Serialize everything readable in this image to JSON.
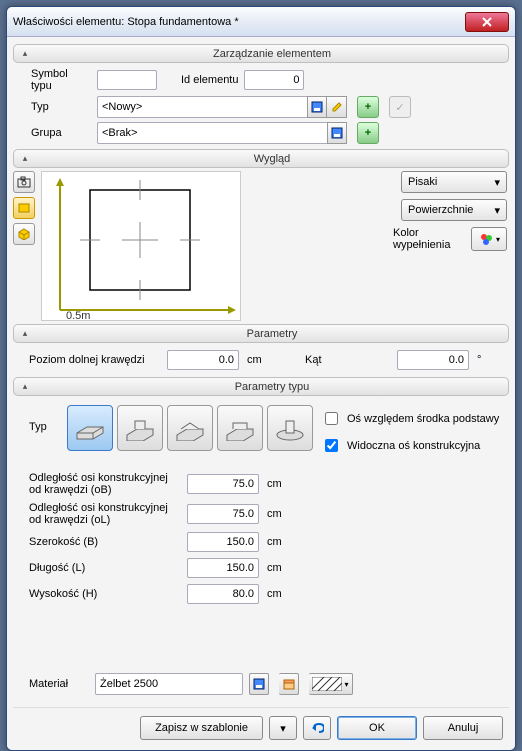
{
  "title": "Właściwości elementu: Stopa fundamentowa *",
  "sections": {
    "management": "Zarządzanie elementem",
    "appearance": "Wygląd",
    "params": "Parametry",
    "type_params": "Parametry typu"
  },
  "labels": {
    "symbol_typu": "Symbol typu",
    "id_elementu": "Id elementu",
    "typ": "Typ",
    "grupa": "Grupa",
    "pisaki": "Pisaki",
    "powierzchnie": "Powierzchnie",
    "kolor_wypelnienia": "Kolor wypełnienia",
    "poziom_dolnej": "Poziom dolnej krawędzi",
    "kat": "Kąt",
    "os_wzgledem": "Oś względem środka podstawy",
    "widoczna_os": "Widoczna oś konstrukcyjna",
    "odl_ob": "Odległość osi konstrukcyjnej od krawędzi (oB)",
    "odl_ol": "Odległość osi konstrukcyjnej od krawędzi (oL)",
    "szerokosc": "Szerokość (B)",
    "dlugosc": "Długość (L)",
    "wysokosc": "Wysokość (H)",
    "material": "Materiał",
    "zapisz": "Zapisz w szablonie",
    "ok": "OK",
    "anuluj": "Anuluj"
  },
  "values": {
    "symbol_typu": "",
    "id_elementu": "0",
    "typ": "<Nowy>",
    "grupa": "<Brak>",
    "poziom_dolnej": "0.0",
    "kat": "0.0",
    "odl_ob": "75.0",
    "odl_ol": "75.0",
    "szerokosc": "150.0",
    "dlugosc": "150.0",
    "wysokosc": "80.0",
    "material": "Żelbet 2500",
    "scale_label": "0.5m"
  },
  "units": {
    "cm": "cm",
    "deg": "°"
  },
  "checkboxes": {
    "os_wzgledem": false,
    "widoczna_os": true
  }
}
